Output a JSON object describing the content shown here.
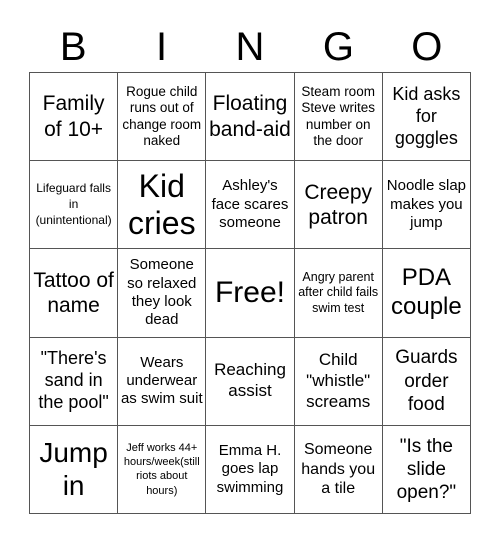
{
  "header": {
    "letters": [
      "B",
      "I",
      "N",
      "G",
      "O"
    ]
  },
  "cells": [
    [
      "Family of 10+",
      "Rogue child runs out of change room naked",
      "Floating band-aid",
      "Steam room Steve writes number on the door",
      "Kid asks for goggles"
    ],
    [
      "Lifeguard falls in (unintentional)",
      "Kid cries",
      "Ashley's face scares someone",
      "Creepy patron",
      "Noodle slap makes you jump"
    ],
    [
      "Tattoo of name",
      "Someone so relaxed they look dead",
      "Free!",
      "Angry parent after child fails swim test",
      "PDA couple"
    ],
    [
      "\"There's sand in the pool\"",
      "Wears underwear as swim suit",
      "Reaching assist",
      "Child \"whistle\" screams",
      "Guards order food"
    ],
    [
      "Jump in",
      "Jeff works 44+ hours/week(still riots about hours)",
      "Emma H. goes lap swimming",
      "Someone hands you a tile",
      "\"Is the slide open?\""
    ]
  ],
  "free_space": {
    "row": 2,
    "col": 2,
    "label": "Free!"
  }
}
